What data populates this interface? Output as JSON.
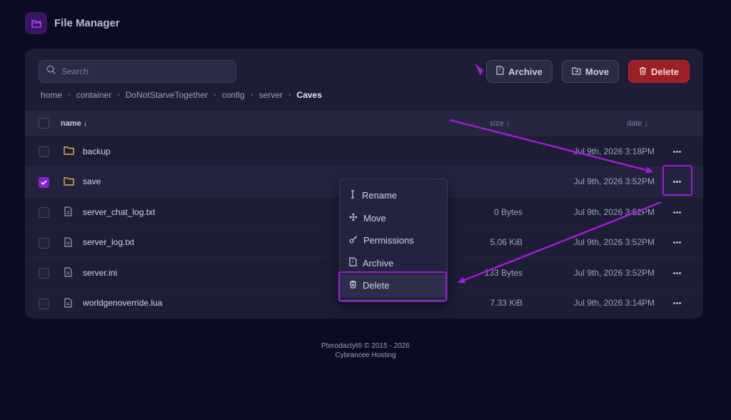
{
  "app": {
    "title": "File Manager"
  },
  "search": {
    "placeholder": "Search"
  },
  "toolbar": {
    "archive_label": "Archive",
    "move_label": "Move",
    "delete_label": "Delete"
  },
  "breadcrumb": {
    "items": [
      "home",
      "container",
      "DoNotStarveTogether",
      "config",
      "server"
    ],
    "current": "Caves"
  },
  "table": {
    "columns": {
      "name": "name ↓",
      "size": "size ↓",
      "date": "date ↓"
    },
    "rows": [
      {
        "name": "backup",
        "type": "folder",
        "size": "",
        "date": "Jul 9th, 2026 3:18PM",
        "selected": false
      },
      {
        "name": "save",
        "type": "folder",
        "size": "",
        "date": "Jul 9th, 2026 3:52PM",
        "selected": true
      },
      {
        "name": "server_chat_log.txt",
        "type": "file",
        "size": "0 Bytes",
        "date": "Jul 9th, 2026 3:52PM",
        "selected": false
      },
      {
        "name": "server_log.txt",
        "type": "file",
        "size": "5.06 KiB",
        "date": "Jul 9th, 2026 3:52PM",
        "selected": false
      },
      {
        "name": "server.ini",
        "type": "file",
        "size": "133 Bytes",
        "date": "Jul 9th, 2026 3:52PM",
        "selected": false
      },
      {
        "name": "worldgenoverride.lua",
        "type": "file",
        "size": "7.33 KiB",
        "date": "Jul 9th, 2026 3:14PM",
        "selected": false
      }
    ]
  },
  "context_menu": {
    "items": [
      "Rename",
      "Move",
      "Permissions",
      "Archive",
      "Delete"
    ]
  },
  "footer": {
    "line1": "Pterodactyl® © 2015 - 2026",
    "line2": "Cybrancee Hosting"
  },
  "colors": {
    "accent": "#8a1fd0",
    "annotation": "#a21ad6",
    "danger": "#9b1f24",
    "folder": "#e0b341"
  },
  "icons": {
    "folder": "folder-icon",
    "file": "file-icon",
    "more": "more-dots-icon"
  }
}
